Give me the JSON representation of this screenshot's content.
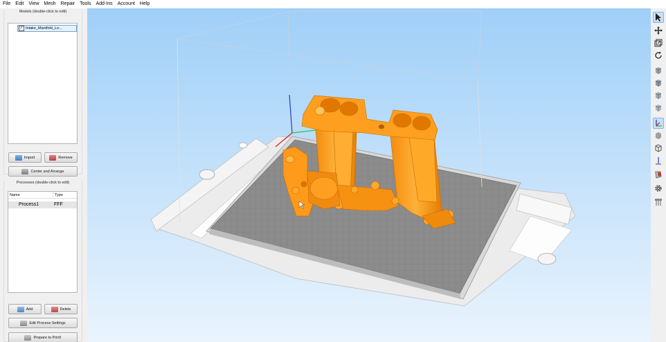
{
  "menu": [
    "File",
    "Edit",
    "View",
    "Mesh",
    "Repair",
    "Tools",
    "Add-Ins",
    "Account",
    "Help"
  ],
  "models": {
    "title": "Models (double-click to edit)",
    "items": [
      {
        "name": "Intake_Manifold_Lo...",
        "checked": true
      }
    ],
    "import_label": "Import",
    "remove_label": "Remove",
    "center_label": "Center and Arrange"
  },
  "processes": {
    "title": "Processes (double-click to edit)",
    "columns": [
      "Name",
      "Type"
    ],
    "rows": [
      {
        "name": "Process1",
        "type": "FFF"
      }
    ],
    "add_label": "Add",
    "delete_label": "Delete",
    "edit_label": "Edit Process Settings",
    "prepare_label": "Prepare to Print!"
  },
  "colors": {
    "model": "#ff9a1a",
    "bed": "#8c8c8c",
    "sky_top": "#9fcff8",
    "sky_bottom": "#eaf4fd"
  },
  "toolbar_icons": [
    "select-cursor-icon",
    "move-icon",
    "scale-icon",
    "rotate-icon",
    "view-cube-front-icon",
    "view-cube-top-icon",
    "view-cube-side-icon",
    "view-cube-iso-icon",
    "axes-icon",
    "solid-view-icon",
    "wireframe-view-icon",
    "section-view-icon",
    "cut-model-icon",
    "settings-gear-icon",
    "support-structures-icon"
  ]
}
